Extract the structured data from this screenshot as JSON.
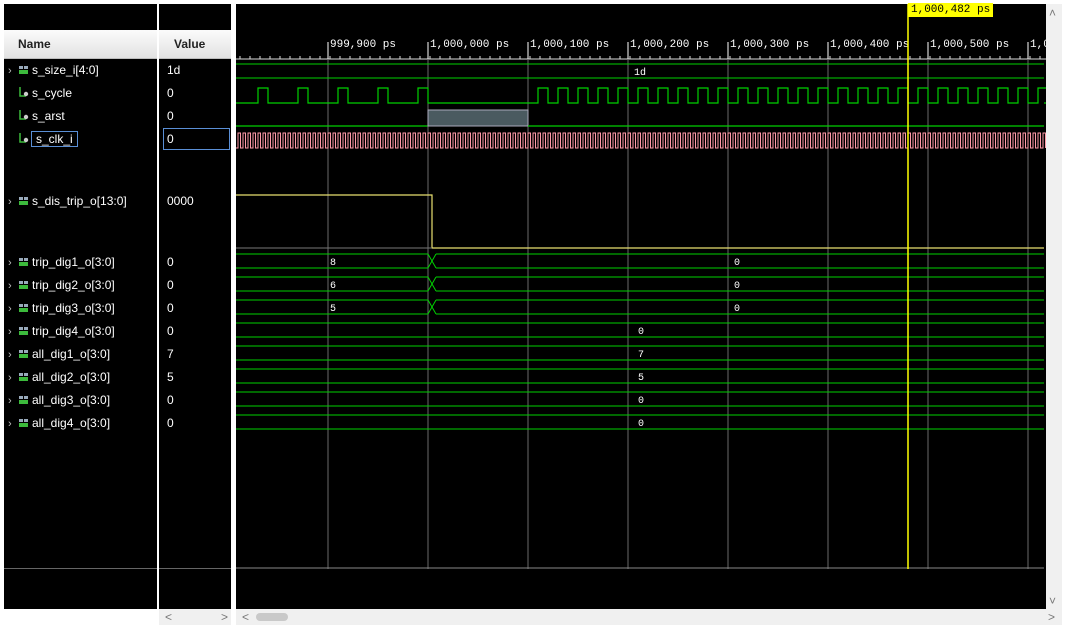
{
  "header": {
    "name_label": "Name",
    "value_label": "Value"
  },
  "signals": [
    {
      "name": "s_size_i[4:0]",
      "value": "1d",
      "expandable": true,
      "icon": "bus-icon"
    },
    {
      "name": "s_cycle",
      "value": "0",
      "expandable": false,
      "icon": "bit-icon"
    },
    {
      "name": "s_arst",
      "value": "0",
      "expandable": false,
      "icon": "bit-icon"
    },
    {
      "name": "s_clk_i",
      "value": "0",
      "expandable": false,
      "icon": "bit-icon",
      "selected": true
    },
    {
      "name": "s_dis_trip_o[13:0]",
      "value": "0000",
      "expandable": true,
      "icon": "bus-icon"
    },
    {
      "name": "trip_dig1_o[3:0]",
      "value": "0",
      "expandable": true,
      "icon": "bus-icon"
    },
    {
      "name": "trip_dig2_o[3:0]",
      "value": "0",
      "expandable": true,
      "icon": "bus-icon"
    },
    {
      "name": "trip_dig3_o[3:0]",
      "value": "0",
      "expandable": true,
      "icon": "bus-icon"
    },
    {
      "name": "trip_dig4_o[3:0]",
      "value": "0",
      "expandable": true,
      "icon": "bus-icon"
    },
    {
      "name": "all_dig1_o[3:0]",
      "value": "7",
      "expandable": true,
      "icon": "bus-icon"
    },
    {
      "name": "all_dig2_o[3:0]",
      "value": "5",
      "expandable": true,
      "icon": "bus-icon"
    },
    {
      "name": "all_dig3_o[3:0]",
      "value": "0",
      "expandable": true,
      "icon": "bus-icon"
    },
    {
      "name": "all_dig4_o[3:0]",
      "value": "0",
      "expandable": true,
      "icon": "bus-icon"
    }
  ],
  "timeline": {
    "ticks": [
      "999,900 ps",
      "1,000,000 ps",
      "1,000,100 ps",
      "1,000,200 ps",
      "1,000,300 ps",
      "1,000,400 ps",
      "1,000,500 ps",
      "1,0"
    ],
    "cursor_label": "1,000,482 ps"
  },
  "waves": {
    "s_size_i": "1d",
    "trip_dig1": [
      "8",
      "0"
    ],
    "trip_dig2": [
      "6",
      "0"
    ],
    "trip_dig3": [
      "5",
      "0"
    ],
    "trip_dig4": "0",
    "all_dig1": "7",
    "all_dig2": "5",
    "all_dig3": "0",
    "all_dig4": "0"
  },
  "scroll": {
    "left_arrow": "<",
    "right_arrow": ">",
    "up_arrow": "˄",
    "down_arrow": "˅"
  },
  "colors": {
    "bus": "#00d000",
    "bit": "#00d000",
    "clock": "#ff9aa8",
    "cursor": "#ffff00",
    "dis_trip": "#e8e070"
  }
}
